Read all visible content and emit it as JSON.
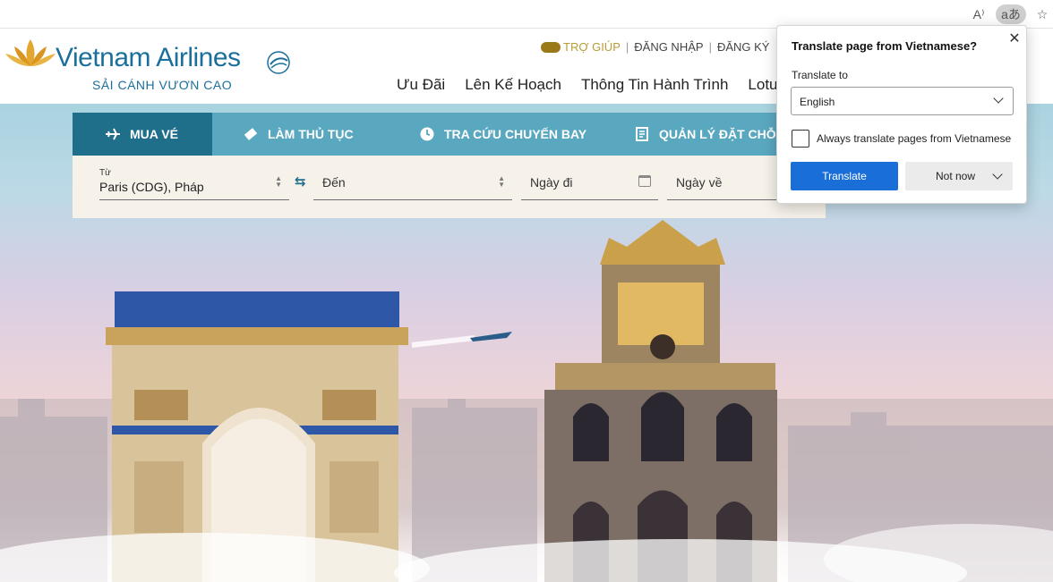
{
  "browser": {
    "read_aloud_icon": "A⁾",
    "translate_icon": "aあ",
    "favorites_icon": "☆"
  },
  "site": {
    "logo_name": "Vietnam Airlines",
    "logo_slogan": "SẢI CÁNH VƯƠN CAO",
    "util": {
      "help": "TRỢ GIÚP",
      "login": "ĐĂNG NHẬP",
      "register": "ĐĂNG KÝ"
    },
    "nav": [
      "Ưu Đãi",
      "Lên Kế Hoạch",
      "Thông Tin Hành Trình",
      "Lotusmiles"
    ]
  },
  "booking": {
    "tabs": [
      {
        "label": "MUA VÉ",
        "icon": "plane-icon",
        "active": true
      },
      {
        "label": "LÀM THỦ TỤC",
        "icon": "ticket-icon",
        "active": false
      },
      {
        "label": "TRA CỨU CHUYẾN BAY",
        "icon": "clock-icon",
        "active": false
      },
      {
        "label": "QUẢN LÝ ĐẶT CHỖ",
        "icon": "document-icon",
        "active": false
      }
    ],
    "from_label": "Từ",
    "from_value": "Paris (CDG), Pháp",
    "to_placeholder": "Đến",
    "depart_placeholder": "Ngày đi",
    "return_placeholder": "Ngày về"
  },
  "translate_popup": {
    "title": "Translate page from Vietnamese?",
    "translate_to_label": "Translate to",
    "selected_language": "English",
    "always_label": "Always translate pages from Vietnamese",
    "always_checked": false,
    "translate_button": "Translate",
    "not_now_button": "Not now"
  },
  "colors": {
    "brand_blue": "#1b6f9b",
    "tab_bar": "#5aa8c0",
    "tab_active": "#1f6f8b",
    "translate_button": "#1a6ed8",
    "gold": "#b89c36"
  }
}
